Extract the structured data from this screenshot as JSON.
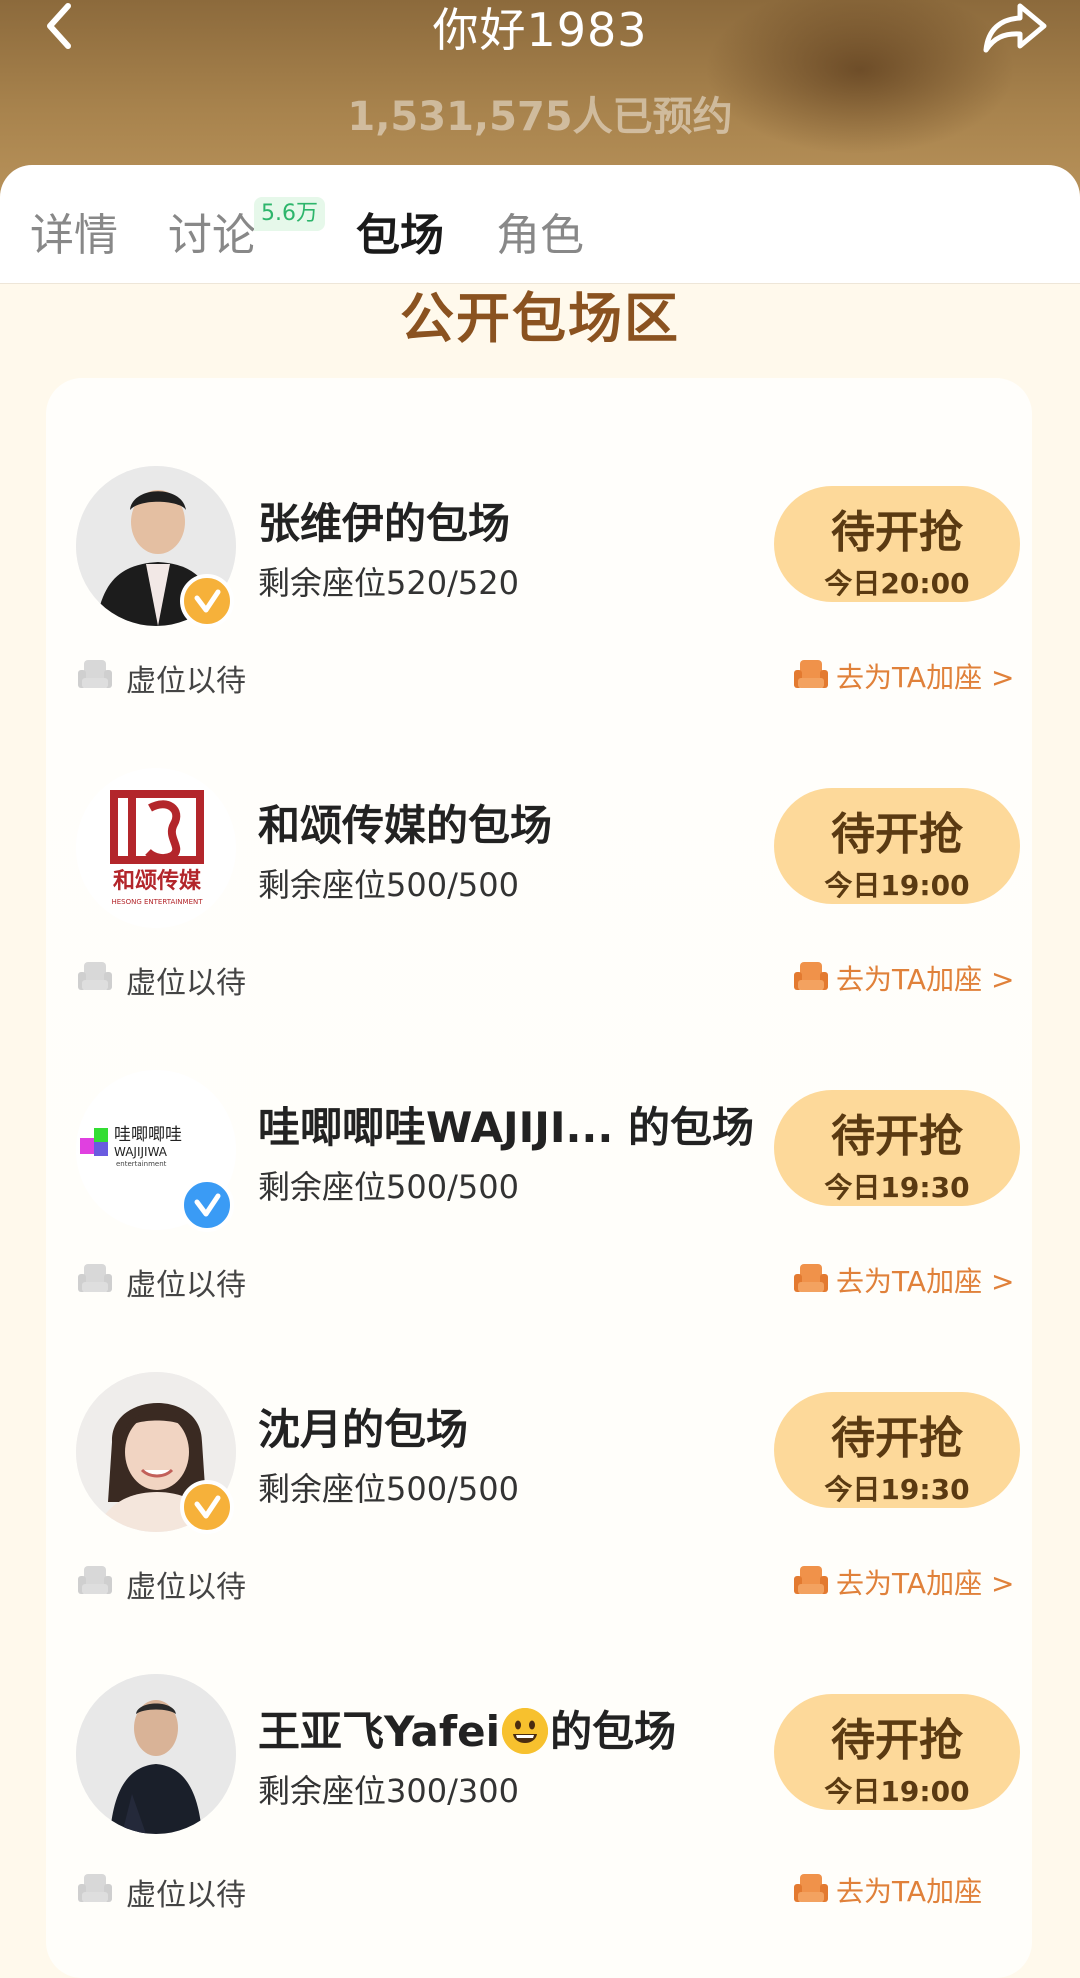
{
  "header": {
    "title": "你好1983",
    "subtitle": "1,531,575人已预约"
  },
  "tabs": [
    {
      "label": "详情"
    },
    {
      "label": "讨论",
      "badge": "5.6万"
    },
    {
      "label": "包场"
    },
    {
      "label": "角色"
    }
  ],
  "section_title": "公开包场区",
  "items": [
    {
      "name": "张维伊的包场",
      "seats": "剩余座位520/520",
      "button": "待开抢",
      "time": "今日20:00",
      "wait_label": "虚位以待",
      "add_label": "去为TA加座 >",
      "verify": "gold"
    },
    {
      "name": "和颂传媒的包场",
      "seats": "剩余座位500/500",
      "button": "待开抢",
      "time": "今日19:00",
      "wait_label": "虚位以待",
      "add_label": "去为TA加座 >",
      "logo_text": "和颂传媒",
      "logo_sub": "HESONG ENTERTAINMENT"
    },
    {
      "name": "哇唧唧哇WAJIJI... 的包场",
      "seats": "剩余座位500/500",
      "button": "待开抢",
      "time": "今日19:30",
      "wait_label": "虚位以待",
      "add_label": "去为TA加座 >",
      "verify": "blue",
      "logo_text": "哇唧唧哇",
      "logo_sub": "WAJIJIWA",
      "logo_sub2": "entertainment"
    },
    {
      "name": "沈月的包场",
      "seats": "剩余座位500/500",
      "button": "待开抢",
      "time": "今日19:30",
      "wait_label": "虚位以待",
      "add_label": "去为TA加座 >",
      "verify": "gold"
    },
    {
      "name_pre": "王亚飞Yafei",
      "name_post": "的包场",
      "seats": "剩余座位300/300",
      "button": "待开抢",
      "time": "今日19:00",
      "wait_label": "虚位以待",
      "add_label": "去为TA加座"
    }
  ],
  "colors": {
    "accent": "#E0813A",
    "button_bg": "#FDD99A",
    "section_title": "#8A5220",
    "badge_bg": "#E6F8EA",
    "badge_text": "#2DB56B"
  }
}
